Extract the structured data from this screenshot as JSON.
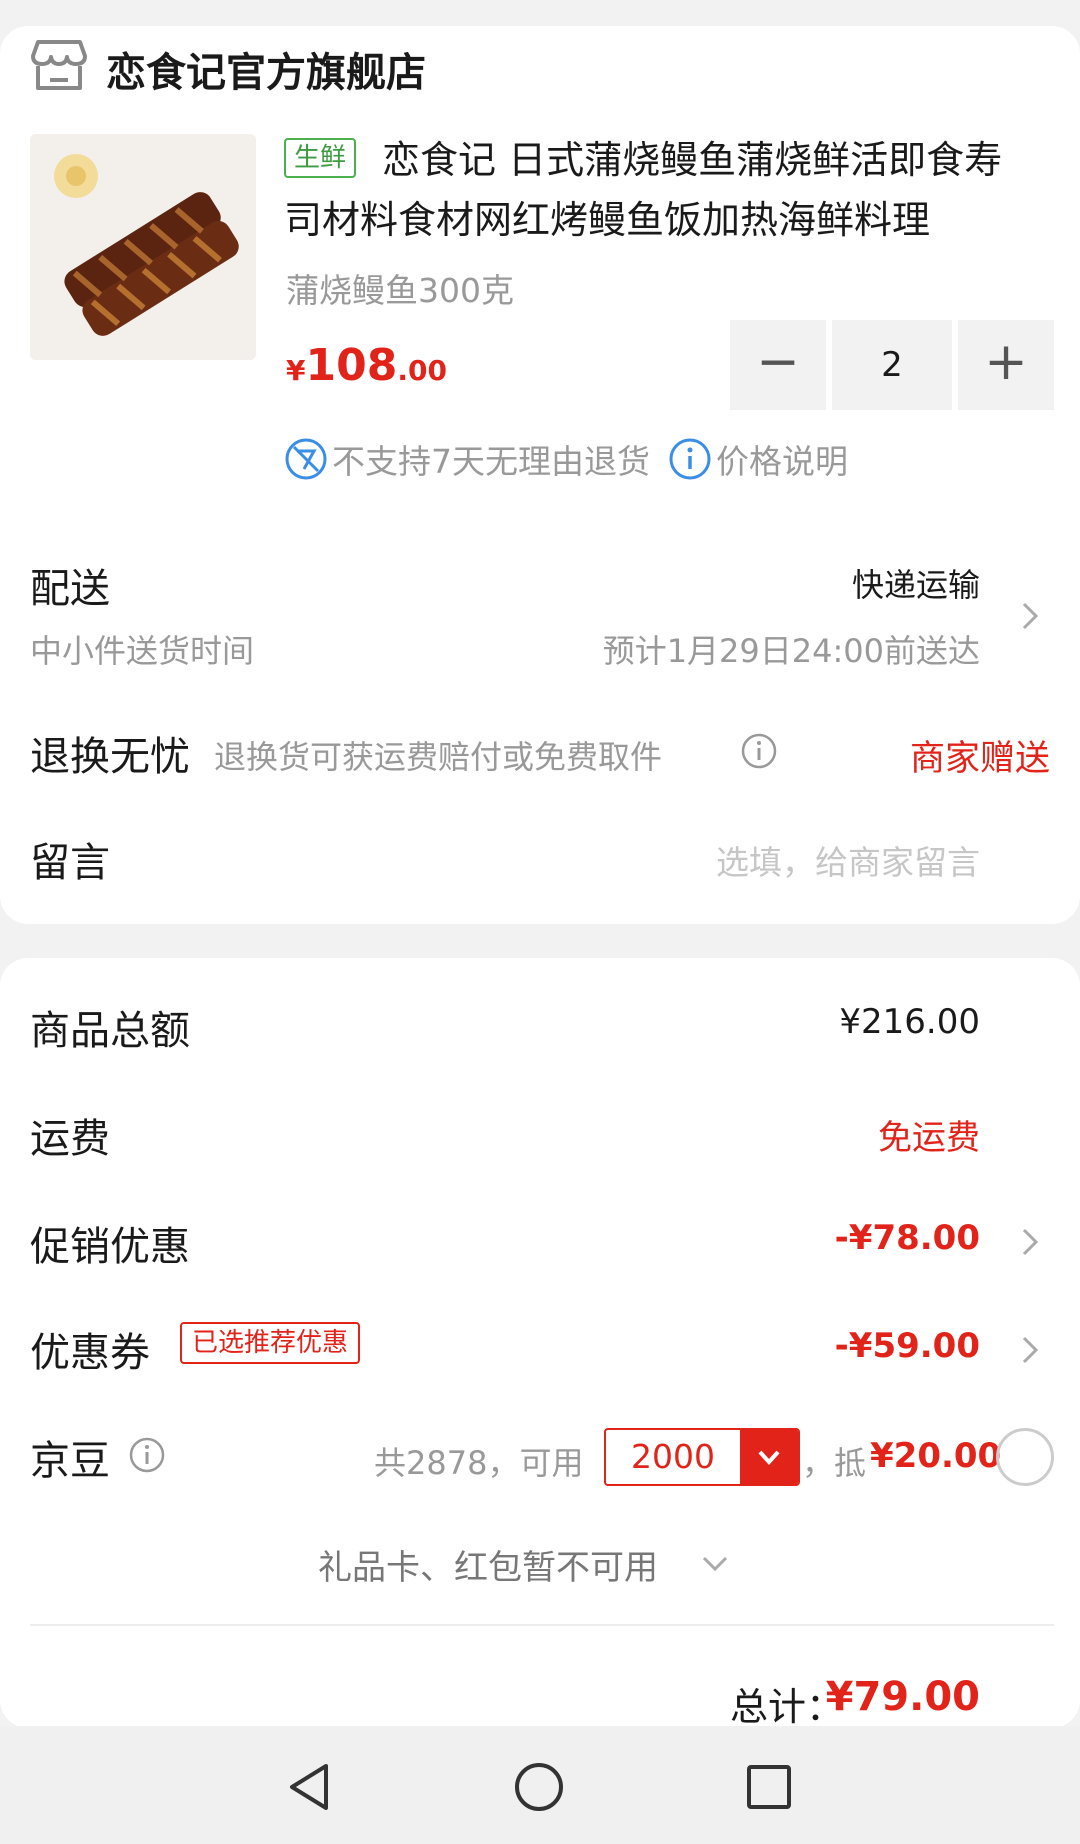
{
  "shop": {
    "name": "恋食记官方旗舰店",
    "icon": "store-icon"
  },
  "product": {
    "badge": "生鲜",
    "title": "恋食记 日式蒲烧鳗鱼蒲烧鲜活即食寿司材料食材网红烤鳗鱼饭加热海鲜料理",
    "variant": "蒲烧鳗鱼300克",
    "price_currency": "¥",
    "price_int": "108",
    "price_dec": ".00",
    "quantity": "2",
    "decrement_label": "−",
    "increment_label": "+",
    "no_return_text": "不支持7天无理由退货",
    "price_info_text": "价格说明"
  },
  "delivery": {
    "label": "配送",
    "method": "快递运输",
    "time_label": "中小件送货时间",
    "eta": "预计1月29日24:00前送达"
  },
  "return_worry_free": {
    "label": "退换无忧",
    "desc": "退换货可获运费赔付或免费取件",
    "value": "商家赠送"
  },
  "message": {
    "label": "留言",
    "placeholder": "选填，给商家留言"
  },
  "summary": {
    "goods_total_label": "商品总额",
    "goods_total": "¥216.00",
    "shipping_label": "运费",
    "shipping": "免运费",
    "promo_label": "促销优惠",
    "promo": "-¥78.00",
    "coupon_label": "优惠券",
    "coupon_tag": "已选推荐优惠",
    "coupon": "-¥59.00",
    "jd_bean_label": "京豆",
    "jd_bean_available": "共2878，可用",
    "jd_bean_selected": "2000",
    "jd_bean_deduct_prefix": "，抵",
    "jd_bean_deduct": "¥20.00",
    "gift_card_text": "礼品卡、红包暂不可用",
    "total_label": "总计：",
    "total": "¥79.00"
  },
  "colors": {
    "accent": "#e2231a",
    "fresh_green": "#4caf50",
    "gray_text": "#999999"
  }
}
